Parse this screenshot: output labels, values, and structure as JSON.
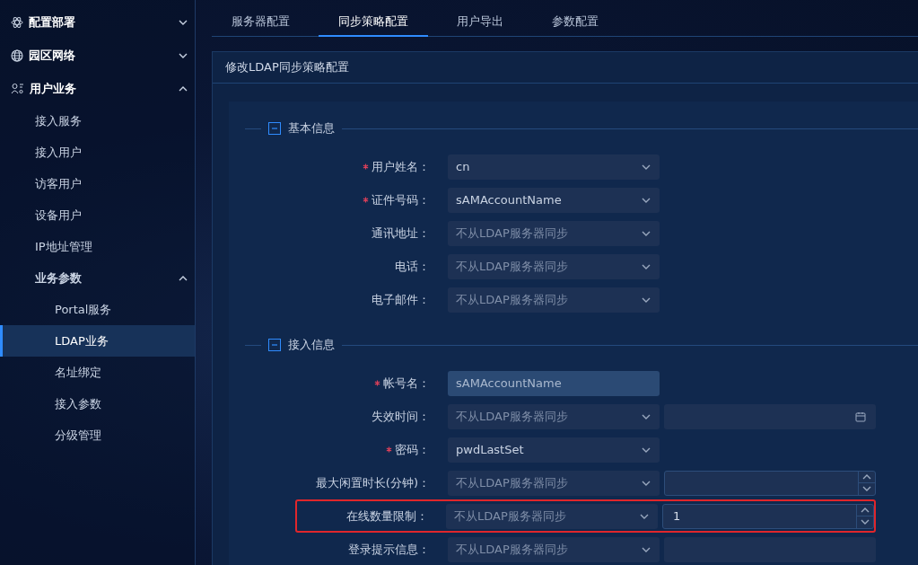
{
  "sidebar": {
    "items": [
      {
        "label": "配置部署",
        "expanded": false
      },
      {
        "label": "园区网络",
        "expanded": false
      },
      {
        "label": "用户业务",
        "expanded": true,
        "children": [
          {
            "label": "接入服务",
            "selected": false
          },
          {
            "label": "接入用户",
            "selected": false
          },
          {
            "label": "访客用户",
            "selected": false
          },
          {
            "label": "设备用户",
            "selected": false
          },
          {
            "label": "IP地址管理",
            "selected": false
          },
          {
            "label": "业务参数",
            "selected": false,
            "expanded": true,
            "children": [
              {
                "label": "Portal服务",
                "selected": false
              },
              {
                "label": "LDAP业务",
                "selected": true
              },
              {
                "label": "名址绑定",
                "selected": false
              },
              {
                "label": "接入参数",
                "selected": false
              },
              {
                "label": "分级管理",
                "selected": false
              }
            ]
          }
        ]
      }
    ]
  },
  "tabs": [
    {
      "label": "服务器配置",
      "selected": false
    },
    {
      "label": "同步策略配置",
      "selected": true
    },
    {
      "label": "用户导出",
      "selected": false
    },
    {
      "label": "参数配置",
      "selected": false
    }
  ],
  "panel": {
    "title": "修改LDAP同步策略配置",
    "sections": [
      {
        "title": "基本信息",
        "expanded": true,
        "fields": [
          {
            "label": "用户姓名：",
            "required": true,
            "kind": "select",
            "value": "cn",
            "highlighted": false
          },
          {
            "label": "证件号码：",
            "required": true,
            "kind": "select",
            "value": "sAMAccountName",
            "highlighted": false
          },
          {
            "label": "通讯地址：",
            "required": false,
            "kind": "select",
            "placeholder": "不从LDAP服务器同步",
            "highlighted": false
          },
          {
            "label": "电话：",
            "required": false,
            "kind": "select",
            "placeholder": "不从LDAP服务器同步",
            "highlighted": false
          },
          {
            "label": "电子邮件：",
            "required": false,
            "kind": "select",
            "placeholder": "不从LDAP服务器同步",
            "highlighted": false
          }
        ]
      },
      {
        "title": "接入信息",
        "expanded": true,
        "fields": [
          {
            "label": "帐号名：",
            "required": true,
            "kind": "text",
            "value": "sAMAccountName",
            "highlighted": false
          },
          {
            "label": "失效时间：",
            "required": false,
            "kind": "select",
            "placeholder": "不从LDAP服务器同步",
            "extra": {
              "kind": "date"
            },
            "highlighted": false
          },
          {
            "label": "密码：",
            "required": true,
            "kind": "select",
            "value": "pwdLastSet",
            "highlighted": false
          },
          {
            "label": "最大闲置时长(分钟)：",
            "required": false,
            "kind": "select",
            "placeholder": "不从LDAP服务器同步",
            "extra": {
              "kind": "number"
            },
            "highlighted": false
          },
          {
            "label": "在线数量限制：",
            "required": false,
            "kind": "select",
            "placeholder": "不从LDAP服务器同步",
            "extra": {
              "kind": "number",
              "value": "1"
            },
            "highlighted": true
          },
          {
            "label": "登录提示信息：",
            "required": false,
            "kind": "select",
            "placeholder": "不从LDAP服务器同步",
            "extra": {
              "kind": "text"
            },
            "highlighted": false
          }
        ]
      }
    ]
  }
}
